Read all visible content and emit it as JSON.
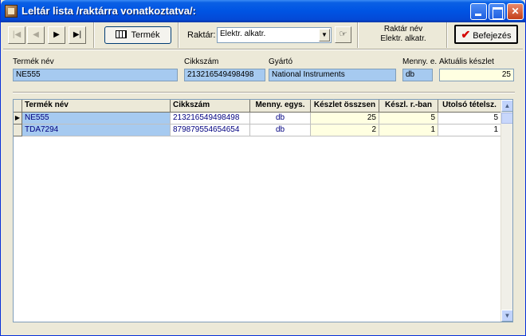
{
  "window": {
    "title": "Leltár lista /raktárra vonatkoztatva/:"
  },
  "toolbar": {
    "termek_label": "Termék",
    "raktar_label": "Raktár:",
    "raktar_value": "Elektr. alkatr.",
    "raktar_nev_label": "Raktár név",
    "raktar_nev_value": "Elektr. alkatr.",
    "befejezes_label": "Befejezés",
    "nav": {
      "first": "|◀",
      "prev": "◀",
      "next": "▶",
      "last": "▶|"
    }
  },
  "fields": {
    "termek_nev": {
      "label": "Termék név",
      "value": "NE555"
    },
    "cikkszam": {
      "label": "Cikkszám",
      "value": "213216549498498"
    },
    "gyarto": {
      "label": "Gyártó",
      "value": "National Instruments"
    },
    "menny_e": {
      "label": "Menny. e.",
      "value": "db"
    },
    "aktualis_keszlet": {
      "label": "Aktuális készlet",
      "value": "25"
    }
  },
  "table": {
    "headers": [
      "Termék név",
      "Cikkszám",
      "Menny. egys.",
      "Készlet összsen",
      "Készl. r.-ban",
      "Utolsó tételsz."
    ],
    "rows": [
      [
        "NE555",
        "213216549498498",
        "db",
        "25",
        "5",
        "5"
      ],
      [
        "TDA7294",
        "879879554654654",
        "db",
        "2",
        "1",
        "1"
      ]
    ]
  },
  "icons": {
    "current_row": "▶",
    "scroll_up": "▲",
    "scroll_down": "▼",
    "combo_arrow": "▼",
    "pointer": "☞",
    "check": "✔"
  }
}
